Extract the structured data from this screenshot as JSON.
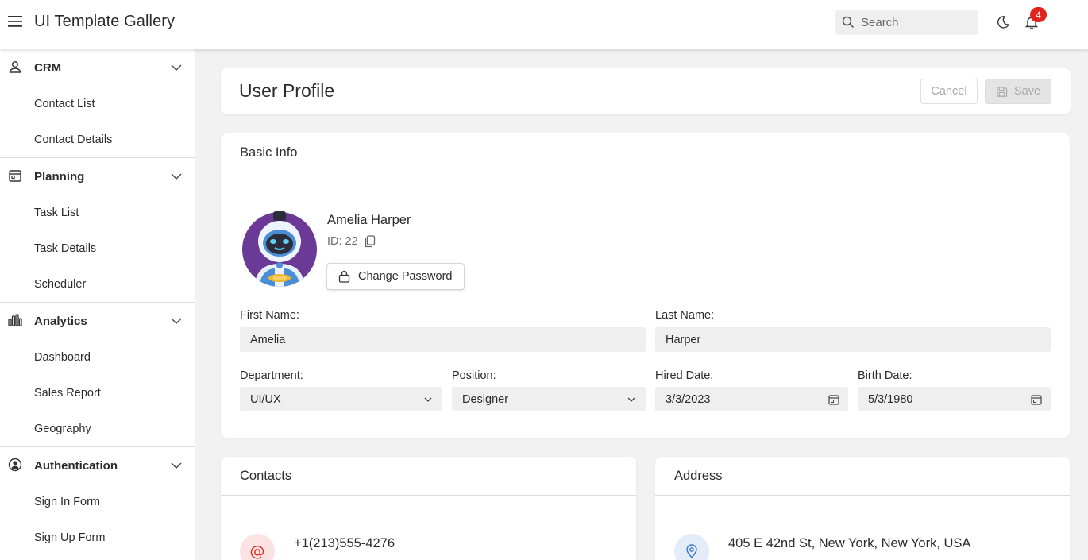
{
  "header": {
    "title": "UI Template Gallery",
    "search_placeholder": "Search",
    "notification_count": "4"
  },
  "sidebar": {
    "groups": [
      {
        "label": "CRM",
        "icon": "user-icon",
        "items": [
          "Contact List",
          "Contact Details"
        ]
      },
      {
        "label": "Planning",
        "icon": "calendar-icon",
        "items": [
          "Task List",
          "Task Details",
          "Scheduler"
        ]
      },
      {
        "label": "Analytics",
        "icon": "chart-icon",
        "items": [
          "Dashboard",
          "Sales Report",
          "Geography"
        ]
      },
      {
        "label": "Authentication",
        "icon": "user-circle-icon",
        "items": [
          "Sign In Form",
          "Sign Up Form"
        ]
      }
    ]
  },
  "page": {
    "title": "User Profile",
    "cancel_label": "Cancel",
    "save_label": "Save"
  },
  "basic_info": {
    "heading": "Basic Info",
    "name": "Amelia Harper",
    "id_label": "ID: 22",
    "change_password_label": "Change Password",
    "first_name_label": "First Name:",
    "first_name": "Amelia",
    "last_name_label": "Last Name:",
    "last_name": "Harper",
    "department_label": "Department:",
    "department": "UI/UX",
    "position_label": "Position:",
    "position": "Designer",
    "hired_label": "Hired Date:",
    "hired": "3/3/2023",
    "birth_label": "Birth Date:",
    "birth": "5/3/1980"
  },
  "contacts": {
    "heading": "Contacts",
    "phone": "+1(213)555-4276",
    "icon_color": "#e3221b"
  },
  "address": {
    "heading": "Address",
    "line": "405 E 42nd St, New York, New York, USA",
    "icon_color": "#3a78c9"
  }
}
